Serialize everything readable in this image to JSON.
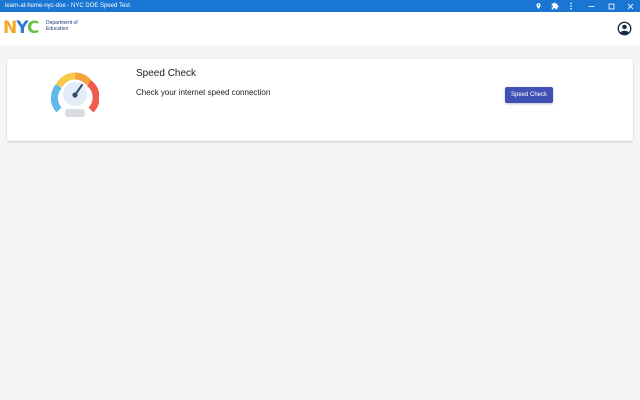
{
  "window": {
    "title": "learn-at-home-nyc-doe - NYC DOE Speed Test",
    "colors": {
      "titlebar": "#1976d2"
    },
    "icons": [
      "location-pin-icon",
      "extensions-icon",
      "more-vert-icon",
      "minimize-icon",
      "maximize-icon",
      "close-icon"
    ]
  },
  "header": {
    "logo": {
      "mark": [
        "N",
        "Y",
        "C"
      ],
      "line1": "Department of",
      "line2": "Education"
    },
    "account_icon": "account-circle-icon"
  },
  "card": {
    "icon": "speedometer-icon",
    "title": "Speed Check",
    "subtitle": "Check your internet speed connection",
    "button_label": "Speed Check",
    "colors": {
      "button": "#3f51b5"
    }
  }
}
